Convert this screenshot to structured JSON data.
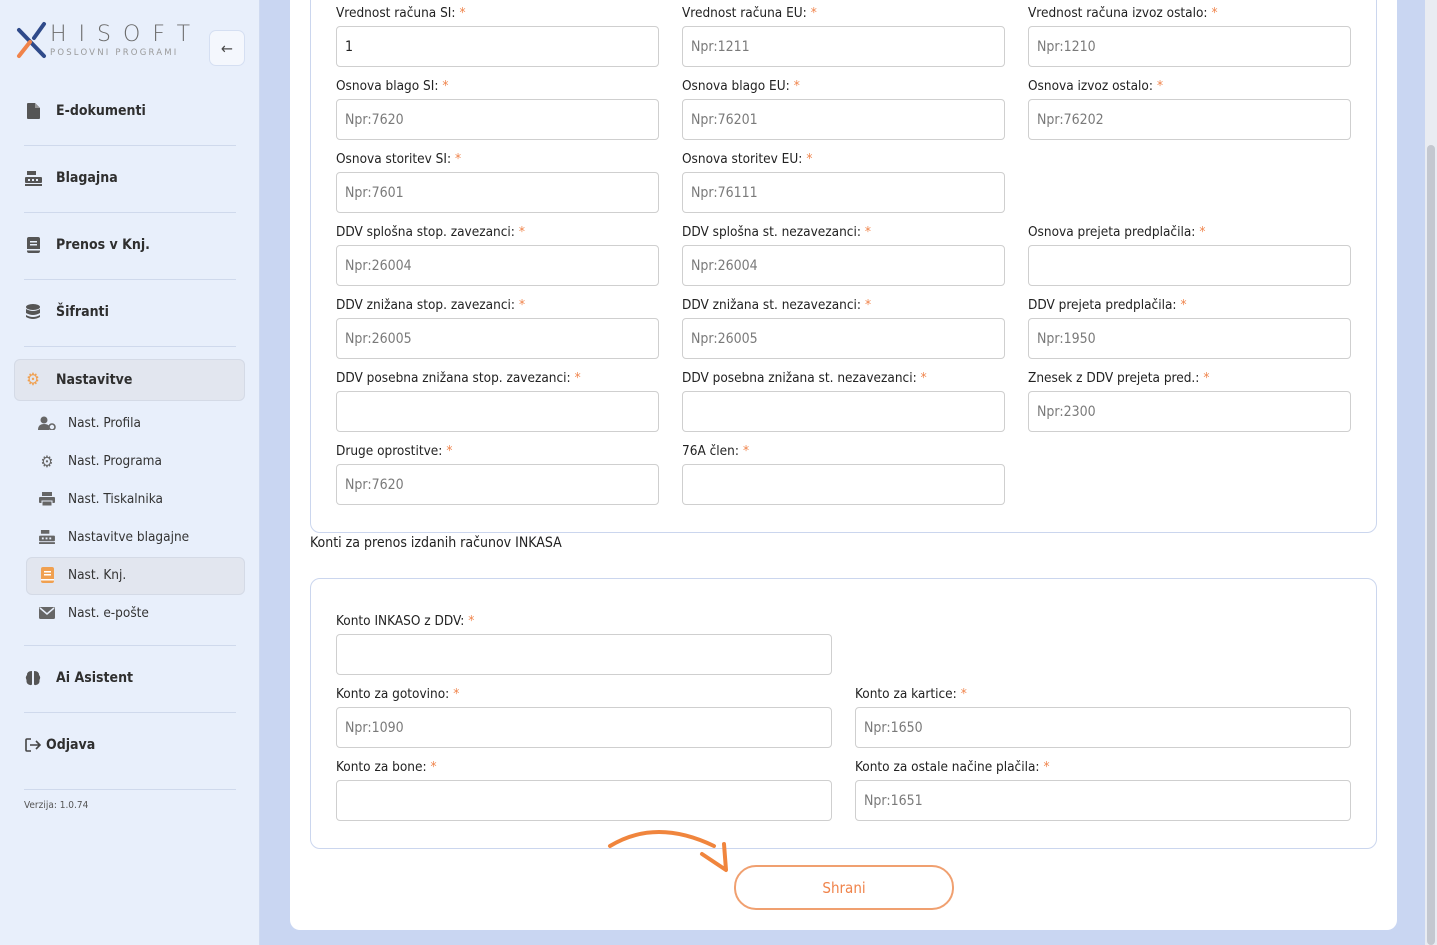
{
  "brand": {
    "name": "HISOFT",
    "tagline": "POSLOVNI PROGRAMI",
    "accent_color": "#f0834a",
    "logo_icon": "hisoft-logo-icon"
  },
  "sidebar": {
    "collapse_icon": "arrow-left-icon",
    "items": [
      {
        "label": "E-dokumenti",
        "icon": "document-icon"
      },
      {
        "label": "Blagajna",
        "icon": "cash-register-icon"
      },
      {
        "label": "Prenos v Knj.",
        "icon": "book-icon"
      },
      {
        "label": "Šifranti",
        "icon": "database-icon"
      },
      {
        "label": "Nastavitve",
        "icon": "gear-icon",
        "active": true
      },
      {
        "label": "Ai Asistent",
        "icon": "brain-icon"
      },
      {
        "label": "Odjava",
        "icon": "logout-icon"
      }
    ],
    "subitems": [
      {
        "label": "Nast. Profila",
        "icon": "user-gear-icon"
      },
      {
        "label": "Nast. Programa",
        "icon": "gear-icon"
      },
      {
        "label": "Nast. Tiskalnika",
        "icon": "printer-icon"
      },
      {
        "label": "Nastavitve blagajne",
        "icon": "cash-register-icon"
      },
      {
        "label": "Nast. Knj.",
        "icon": "book-icon",
        "active": true
      },
      {
        "label": "Nast. e-pošte",
        "icon": "envelope-icon"
      }
    ],
    "version": "Verzija: 1.0.74"
  },
  "form1": {
    "fields": [
      {
        "label": "Vrednost računa SI:",
        "value": "1",
        "placeholder": ""
      },
      {
        "label": "Vrednost računa EU:",
        "value": "",
        "placeholder": "Npr:1211"
      },
      {
        "label": "Vrednost računa izvoz ostalo:",
        "value": "",
        "placeholder": "Npr:1210"
      },
      {
        "label": "Osnova blago SI:",
        "value": "",
        "placeholder": "Npr:7620"
      },
      {
        "label": "Osnova blago EU:",
        "value": "",
        "placeholder": "Npr:76201"
      },
      {
        "label": "Osnova izvoz ostalo:",
        "value": "",
        "placeholder": "Npr:76202"
      },
      {
        "label": "Osnova storitev SI:",
        "value": "",
        "placeholder": "Npr:7601"
      },
      {
        "label": "Osnova storitev EU:",
        "value": "",
        "placeholder": "Npr:76111"
      },
      {
        "label": "DDV splošna stop. zavezanci:",
        "value": "",
        "placeholder": "Npr:26004"
      },
      {
        "label": "DDV splošna st. nezavezanci:",
        "value": "",
        "placeholder": "Npr:26004"
      },
      {
        "label": "Osnova prejeta predplačila:",
        "value": "",
        "placeholder": ""
      },
      {
        "label": "DDV znižana stop. zavezanci:",
        "value": "",
        "placeholder": "Npr:26005"
      },
      {
        "label": "DDV znižana st. nezavezanci:",
        "value": "",
        "placeholder": "Npr:26005"
      },
      {
        "label": "DDV prejeta predplačila:",
        "value": "",
        "placeholder": "Npr:1950"
      },
      {
        "label": "DDV posebna znižana stop. zavezanci:",
        "value": "",
        "placeholder": ""
      },
      {
        "label": "DDV posebna znižana st. nezavezanci:",
        "value": "",
        "placeholder": ""
      },
      {
        "label": "Znesek z DDV prejeta pred.:",
        "value": "",
        "placeholder": "Npr:2300"
      },
      {
        "label": "Druge oprostitve:",
        "value": "",
        "placeholder": "Npr:7620"
      },
      {
        "label": "76A člen:",
        "value": "",
        "placeholder": ""
      }
    ]
  },
  "inkasa": {
    "title": "Konti za prenos izdanih računov INKASA",
    "fields": [
      {
        "label": "Konto INKASO z DDV:",
        "value": "",
        "placeholder": ""
      },
      {
        "label": "Konto za gotovino:",
        "value": "",
        "placeholder": "Npr:1090"
      },
      {
        "label": "Konto za kartice:",
        "value": "",
        "placeholder": "Npr:1650"
      },
      {
        "label": "Konto za bone:",
        "value": "",
        "placeholder": ""
      },
      {
        "label": "Konto za ostale načine plačila:",
        "value": "",
        "placeholder": "Npr:1651"
      }
    ]
  },
  "required_mark": "*",
  "save_label": "Shrani"
}
